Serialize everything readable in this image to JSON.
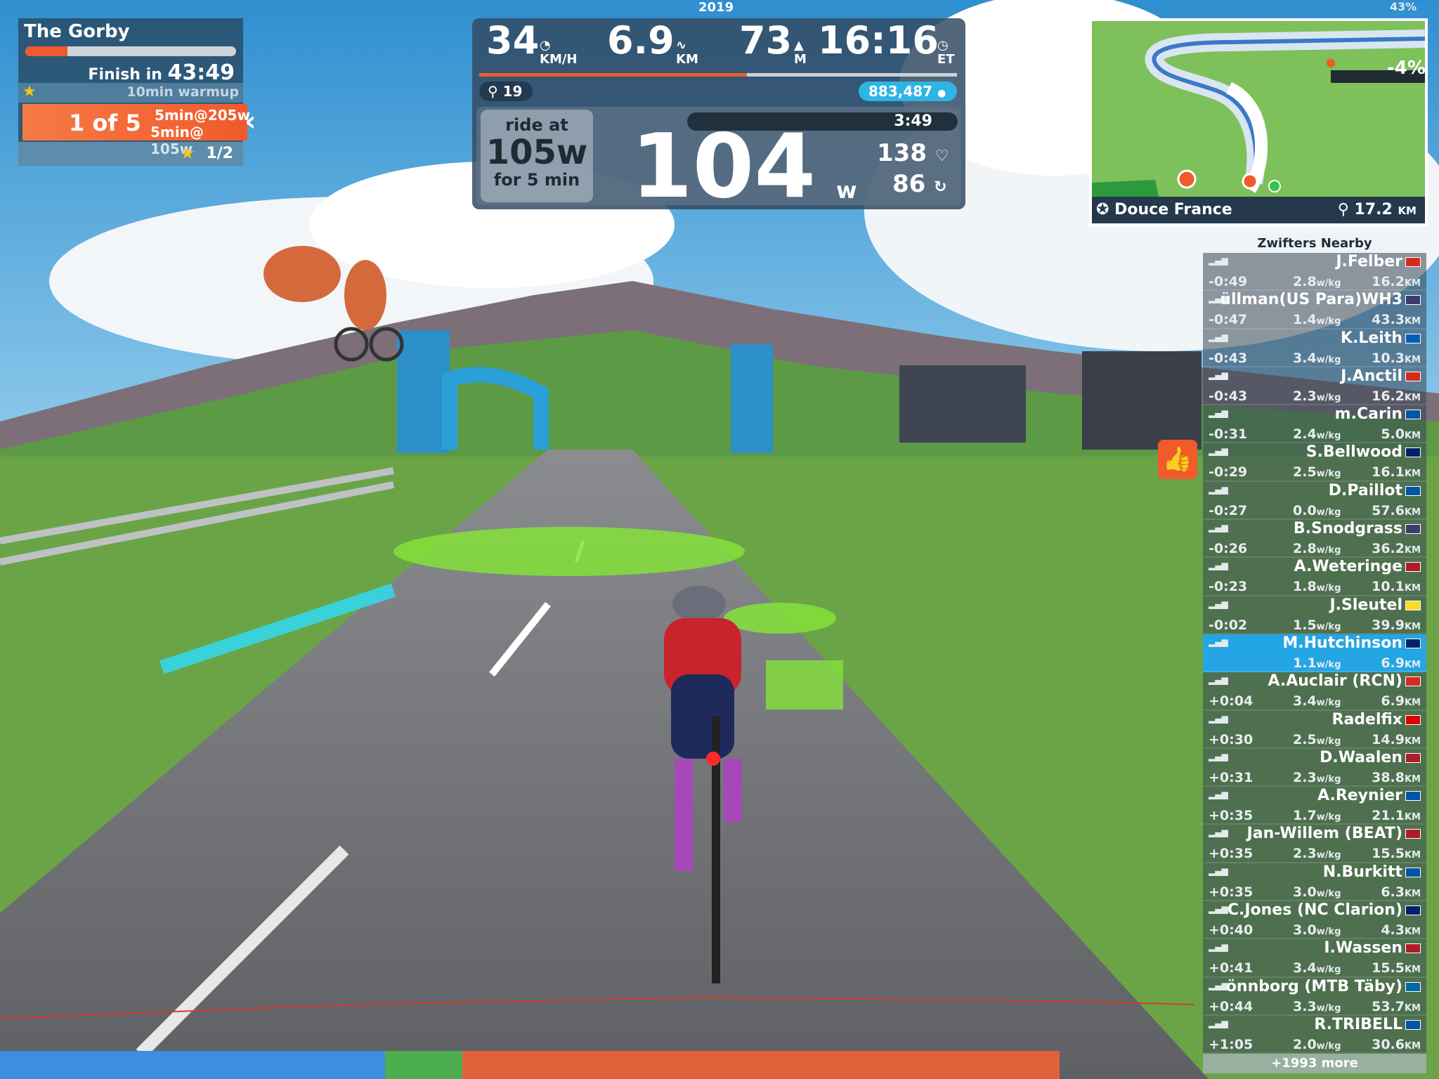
{
  "workout": {
    "title": "The Gorby",
    "progress": 0.2,
    "finish_label": "Finish in",
    "finish_time": "43:49",
    "warmup": "10min warmup",
    "step_of": "1 of 5",
    "step_line1": "5min@205w",
    "step_line2": "5min@ 105w",
    "stars": "1/2"
  },
  "hud": {
    "year": "2019",
    "battery": "43%",
    "speed": "34",
    "speed_unit": "KM/H",
    "distance": "6.9",
    "distance_unit": "KM",
    "elevation": "73",
    "elevation_unit": "M",
    "time": "16:16",
    "time_unit": "ET",
    "progress": 0.56,
    "riders": "19",
    "drops": "883,487",
    "ride_at_1": "ride at",
    "ride_at_2": "105w",
    "ride_at_3": "for 5 min",
    "interval_timer": "3:49",
    "power": "104",
    "power_unit": "w",
    "heart_rate": "138",
    "cadence": "86"
  },
  "map": {
    "world": "Douce France",
    "route_distance": "17.2",
    "route_unit": "KM",
    "grade": "-4%"
  },
  "nearby": {
    "title": "Zwifters Nearby",
    "more": "+1993 more",
    "riders": [
      {
        "name": "J.Felber",
        "gap": "-0:49",
        "wkg": "2.8",
        "dist": "16.2",
        "flag": "#d52b1e"
      },
      {
        "name": "üllman(US Para)WH3",
        "gap": "-0:47",
        "wkg": "1.4",
        "dist": "43.3",
        "flag": "#3c3b6e"
      },
      {
        "name": "K.Leith",
        "gap": "-0:43",
        "wkg": "3.4",
        "dist": "10.3",
        "flag": "#005eb8"
      },
      {
        "name": "J.Anctil",
        "gap": "-0:43",
        "wkg": "2.3",
        "dist": "16.2",
        "flag": "#d52b1e"
      },
      {
        "name": "m.Carin",
        "gap": "-0:31",
        "wkg": "2.4",
        "dist": "5.0",
        "flag": "#0055a4"
      },
      {
        "name": "S.Bellwood",
        "gap": "-0:29",
        "wkg": "2.5",
        "dist": "16.1",
        "flag": "#012169"
      },
      {
        "name": "D.Paillot",
        "gap": "-0:27",
        "wkg": "0.0",
        "dist": "57.6",
        "flag": "#0055a4"
      },
      {
        "name": "B.Snodgrass",
        "gap": "-0:26",
        "wkg": "2.8",
        "dist": "36.2",
        "flag": "#3c3b6e"
      },
      {
        "name": "A.Weteringe",
        "gap": "-0:23",
        "wkg": "1.8",
        "dist": "10.1",
        "flag": "#ae1c28"
      },
      {
        "name": "J.Sleutel",
        "gap": "-0:02",
        "wkg": "1.5",
        "dist": "39.9",
        "flag": "#fdda24"
      },
      {
        "name": "M.Hutchinson",
        "gap": "",
        "wkg": "1.1",
        "dist": "6.9",
        "flag": "#012169"
      },
      {
        "name": "A.Auclair (RCN)",
        "gap": "+0:04",
        "wkg": "3.4",
        "dist": "6.9",
        "flag": "#d52b1e"
      },
      {
        "name": "Radelfix",
        "gap": "+0:30",
        "wkg": "2.5",
        "dist": "14.9",
        "flag": "#dd0000"
      },
      {
        "name": "D.Waalen",
        "gap": "+0:31",
        "wkg": "2.3",
        "dist": "38.8",
        "flag": "#ae1c28"
      },
      {
        "name": "A.Reynier",
        "gap": "+0:35",
        "wkg": "1.7",
        "dist": "21.1",
        "flag": "#0055a4"
      },
      {
        "name": "Jan-Willem (BEAT)",
        "gap": "+0:35",
        "wkg": "2.3",
        "dist": "15.5",
        "flag": "#ae1c28"
      },
      {
        "name": "N.Burkitt",
        "gap": "+0:35",
        "wkg": "3.0",
        "dist": "6.3",
        "flag": "#0055a4"
      },
      {
        "name": "C.Jones (NC Clarion)",
        "gap": "+0:40",
        "wkg": "3.0",
        "dist": "4.3",
        "flag": "#012169"
      },
      {
        "name": "I.Wassen",
        "gap": "+0:41",
        "wkg": "3.4",
        "dist": "15.5",
        "flag": "#ae1c28"
      },
      {
        "name": "önnborg (MTB Täby)",
        "gap": "+0:44",
        "wkg": "3.3",
        "dist": "53.7",
        "flag": "#006aa7"
      },
      {
        "name": "R.TRIBELL",
        "gap": "+1:05",
        "wkg": "2.0",
        "dist": "30.6",
        "flag": "#0055a4"
      }
    ],
    "wkg_unit": "w/kg",
    "dist_unit": "KM"
  },
  "colors": {
    "accent": "#f15a2b",
    "hud_bg": "#324b64",
    "highlight": "#24a5e4",
    "star": "#f7c31a"
  }
}
